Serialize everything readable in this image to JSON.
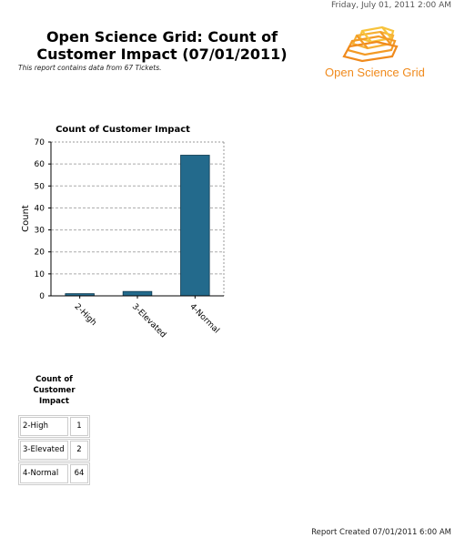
{
  "header": {
    "datetime": "Friday, July 01, 2011 2:00 AM",
    "title_line1": "Open Science Grid: Count of",
    "title_line2": "Customer Impact (07/01/2011)",
    "subtitle": "This report contains data from 67 Tickets.",
    "logo_text": "Open Science Grid",
    "logo_icon": "osg-logo-icon"
  },
  "colors": {
    "bar": "#236a8c",
    "logo_orange": "#f08a1c",
    "logo_yellow": "#f7c33c"
  },
  "chart_data": {
    "type": "bar",
    "title": "Count of Customer Impact",
    "xlabel": "",
    "ylabel": "Count",
    "categories": [
      "2-High",
      "3-Elevated",
      "4-Normal"
    ],
    "values": [
      1,
      2,
      64
    ],
    "ylim": [
      0,
      70
    ],
    "yticks": [
      0,
      10,
      20,
      30,
      40,
      50,
      60,
      70
    ],
    "grid": true
  },
  "table": {
    "header": [
      "Count of",
      "Customer",
      "Impact"
    ],
    "rows": [
      {
        "label": "2-High",
        "value": "1"
      },
      {
        "label": "3-Elevated",
        "value": "2"
      },
      {
        "label": "4-Normal",
        "value": "64"
      }
    ]
  },
  "footer": {
    "created": "Report Created 07/01/2011 6:00 AM"
  }
}
